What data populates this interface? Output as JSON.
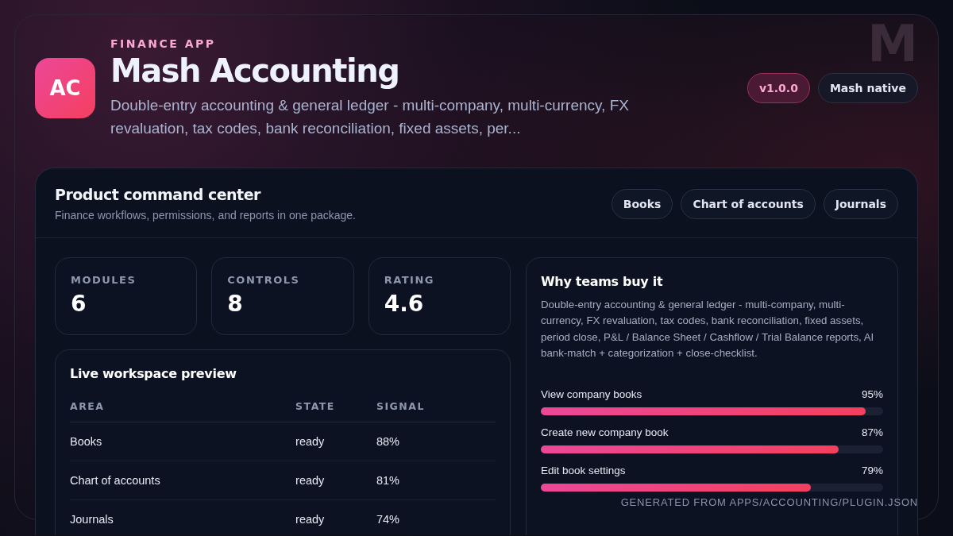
{
  "app": {
    "eyebrow": "FINANCE APP",
    "icon_text": "AC",
    "title": "Mash Accounting",
    "description": "Double-entry accounting & general ledger - multi-company, multi-currency, FX revaluation, tax codes, bank reconciliation, fixed assets, per...",
    "monogram": "M",
    "badges": [
      {
        "label": "v1.0.0",
        "kind": "accent"
      },
      {
        "label": "Mash native",
        "kind": "plain"
      }
    ]
  },
  "panel": {
    "title": "Product command center",
    "subtitle": "Finance workflows, permissions, and reports in one package.",
    "pills": [
      "Books",
      "Chart of accounts",
      "Journals"
    ],
    "stats": [
      {
        "label": "MODULES",
        "value": "6"
      },
      {
        "label": "CONTROLS",
        "value": "8"
      },
      {
        "label": "RATING",
        "value": "4.6"
      }
    ],
    "preview": {
      "title": "Live workspace preview",
      "columns": [
        "AREA",
        "STATE",
        "SIGNAL"
      ],
      "rows": [
        [
          "Books",
          "ready",
          "88%"
        ],
        [
          "Chart of accounts",
          "ready",
          "81%"
        ],
        [
          "Journals",
          "ready",
          "74%"
        ]
      ]
    },
    "why": {
      "title": "Why teams buy it",
      "text": "Double-entry accounting & general ledger - multi-company, multi-currency, FX revaluation, tax codes, bank reconciliation, fixed assets, period close, P&L / Balance Sheet / Cashflow / Trial Balance reports, AI bank-match + categorization + close-checklist.",
      "meters": [
        {
          "label": "View company books",
          "reading": "95%",
          "level": 0.95
        },
        {
          "label": "Create new company book",
          "reading": "87%",
          "level": 0.87
        },
        {
          "label": "Edit book settings",
          "reading": "79%",
          "level": 0.79
        }
      ]
    }
  },
  "footer": "GENERATED FROM APPS/ACCOUNTING/PLUGIN.JSON"
}
